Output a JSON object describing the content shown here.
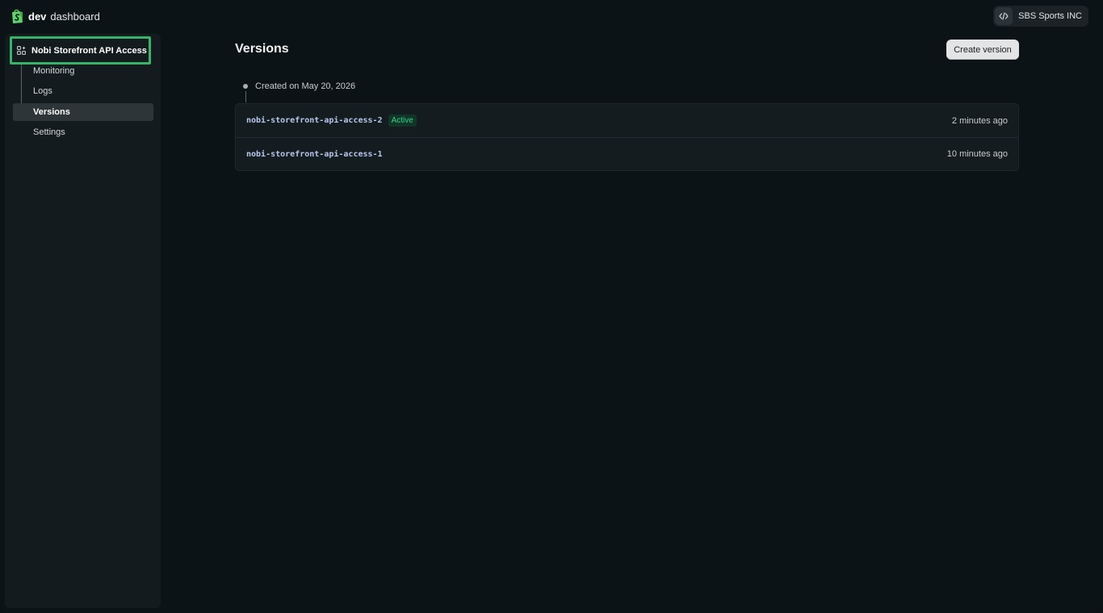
{
  "brand": {
    "bold": "dev",
    "rest": "dashboard"
  },
  "org": {
    "name": "SBS Sports INC",
    "icon": "code-icon"
  },
  "sidebar": {
    "app_title": "Nobi Storefront API Access",
    "app_icon": "apps-grid-icon",
    "items": [
      {
        "label": "Monitoring",
        "active": false
      },
      {
        "label": "Logs",
        "active": false
      },
      {
        "label": "Versions",
        "active": true
      },
      {
        "label": "Settings",
        "active": false
      }
    ]
  },
  "main": {
    "title": "Versions",
    "create_label": "Create version",
    "created_text": "Created on May 20, 2026",
    "versions": [
      {
        "name": "nobi-storefront-api-access-2",
        "badge": "Active",
        "time": "2 minutes ago"
      },
      {
        "name": "nobi-storefront-api-access-1",
        "badge": "",
        "time": "10 minutes ago"
      }
    ]
  },
  "colors": {
    "accent_green": "#36b46b",
    "background": "#0c1316",
    "sidebar_bg": "#131b1e",
    "badge_text": "#2ed58a"
  }
}
